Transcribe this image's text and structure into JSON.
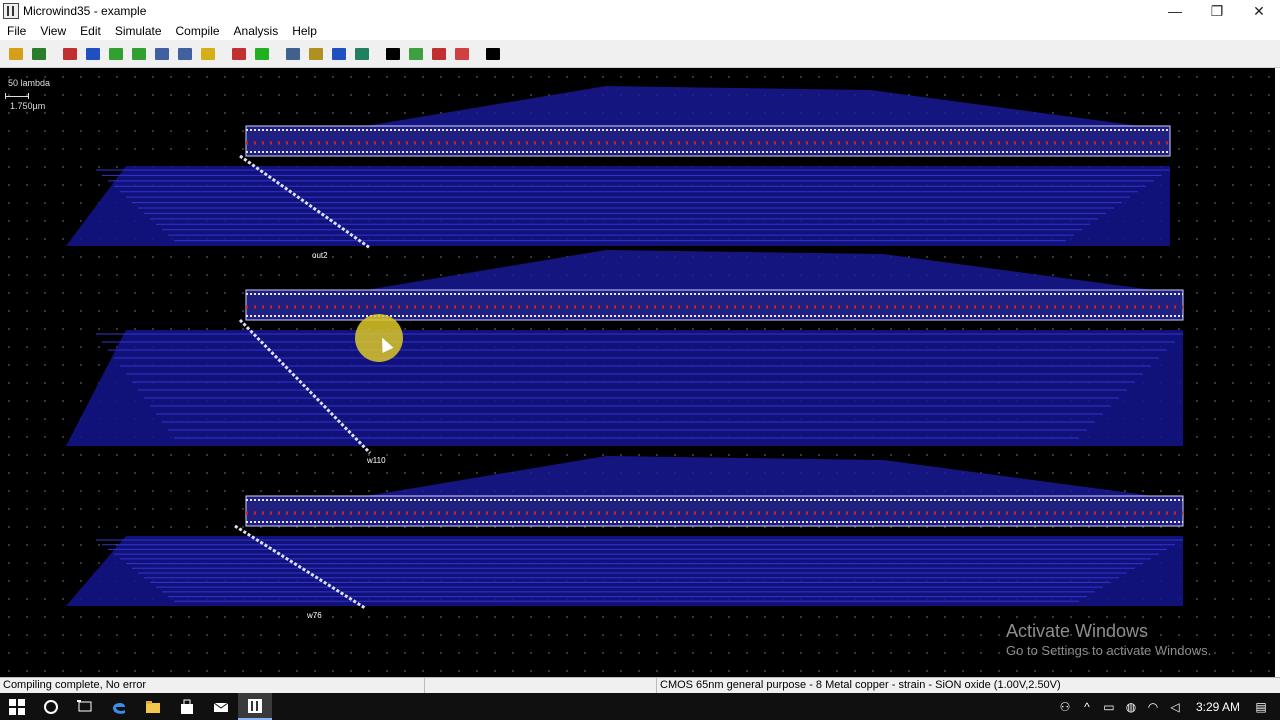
{
  "window": {
    "title": "Microwind35 - example",
    "minimize": "—",
    "restore": "❐",
    "close": "✕"
  },
  "menu": [
    "File",
    "View",
    "Edit",
    "Simulate",
    "Compile",
    "Analysis",
    "Help"
  ],
  "toolbar": {
    "buttons": [
      {
        "name": "open-icon",
        "color": "#d4a017"
      },
      {
        "name": "save-icon",
        "color": "#2a7d2a"
      },
      {
        "name": "sep"
      },
      {
        "name": "draw-box-icon",
        "color": "#c03030"
      },
      {
        "name": "connect-layers-icon",
        "color": "#2050c0"
      },
      {
        "name": "copy-icon",
        "color": "#30a030"
      },
      {
        "name": "stretch-icon",
        "color": "#30a030"
      },
      {
        "name": "zoom-in-icon",
        "color": "#4060a0"
      },
      {
        "name": "zoom-out-icon",
        "color": "#4060a0"
      },
      {
        "name": "measure-icon",
        "color": "#d4b017"
      },
      {
        "name": "sep"
      },
      {
        "name": "cross-section-icon",
        "color": "#c03030"
      },
      {
        "name": "simulate-icon",
        "color": "#20b020"
      },
      {
        "name": "sep"
      },
      {
        "name": "mos-characteristics-icon",
        "color": "#406090"
      },
      {
        "name": "process-view-icon",
        "color": "#b09020"
      },
      {
        "name": "3d-view-icon",
        "color": "#2050c0"
      },
      {
        "name": "design-rule-icon",
        "color": "#208060"
      },
      {
        "name": "sep"
      },
      {
        "name": "text-icon",
        "color": "#000000"
      },
      {
        "name": "properties-icon",
        "color": "#40a040"
      },
      {
        "name": "analysis-icon",
        "color": "#c03030"
      },
      {
        "name": "layers-icon",
        "color": "#d04040"
      },
      {
        "name": "sep"
      },
      {
        "name": "navigate-icon",
        "color": "#000000"
      }
    ]
  },
  "canvas": {
    "scale_label": "50 lambda",
    "scale_um": "1.750µm",
    "labels": [
      "out2",
      "w110",
      "w76"
    ]
  },
  "watermark": {
    "line1": "Activate Windows",
    "line2": "Go to Settings to activate Windows."
  },
  "status": {
    "left": "Compiling complete, No error",
    "right": "CMOS 65nm general purpose - 8 Metal copper - strain - SiON oxide (1.00V,2.50V)"
  },
  "taskbar": {
    "clock": "3:29 AM"
  }
}
